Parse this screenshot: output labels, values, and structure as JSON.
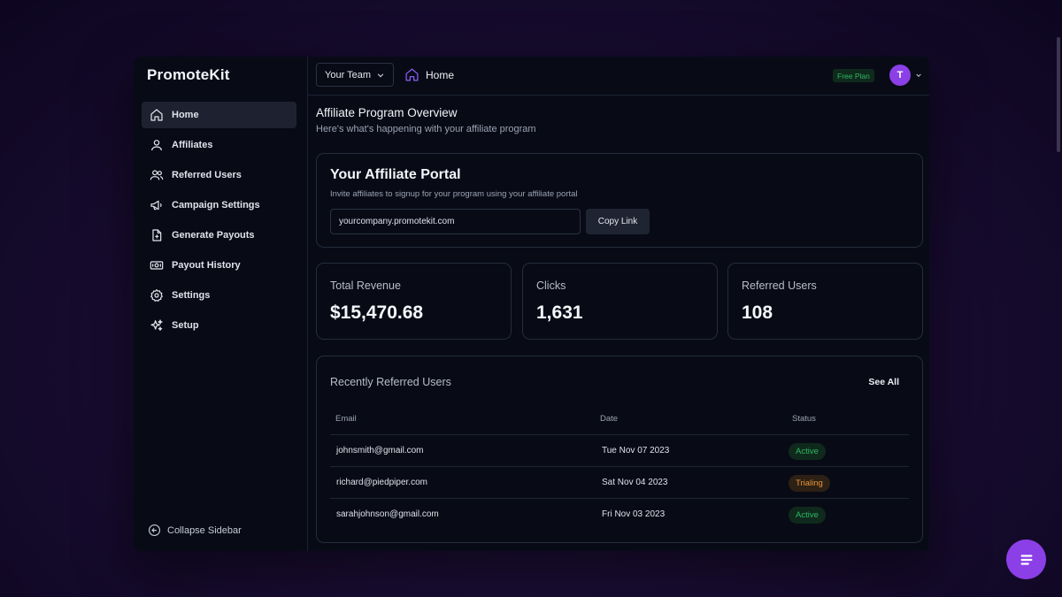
{
  "app": {
    "name": "PromoteKit"
  },
  "sidebar": {
    "items": [
      {
        "label": "Home",
        "icon": "home-icon"
      },
      {
        "label": "Affiliates",
        "icon": "user-icon"
      },
      {
        "label": "Referred Users",
        "icon": "users-icon"
      },
      {
        "label": "Campaign Settings",
        "icon": "megaphone-icon"
      },
      {
        "label": "Generate Payouts",
        "icon": "file-plus-icon"
      },
      {
        "label": "Payout History",
        "icon": "banknote-icon"
      },
      {
        "label": "Settings",
        "icon": "gear-icon"
      },
      {
        "label": "Setup",
        "icon": "sparkles-icon"
      }
    ],
    "collapse_label": "Collapse Sidebar"
  },
  "topbar": {
    "team_select": "Your Team",
    "breadcrumb": "Home",
    "plan": "Free Plan",
    "avatar_initial": "T"
  },
  "overview": {
    "title": "Affiliate Program Overview",
    "subtitle": "Here's what's happening with your affiliate program"
  },
  "portal": {
    "title": "Your Affiliate Portal",
    "subtitle": "Invite affiliates to signup for your program using your affiliate portal",
    "url": "yourcompany.promotekit.com",
    "copy_label": "Copy Link"
  },
  "stats": [
    {
      "label": "Total Revenue",
      "value": "$15,470.68"
    },
    {
      "label": "Clicks",
      "value": "1,631"
    },
    {
      "label": "Referred Users",
      "value": "108"
    }
  ],
  "recent": {
    "title": "Recently Referred Users",
    "see_all": "See All",
    "columns": [
      "Email",
      "Date",
      "Status"
    ],
    "rows": [
      {
        "email": "johnsmith@gmail.com",
        "date": "Tue Nov 07 2023",
        "status": "Active"
      },
      {
        "email": "richard@piedpiper.com",
        "date": "Sat Nov 04 2023",
        "status": "Trialing"
      },
      {
        "email": "sarahjohnson@gmail.com",
        "date": "Fri Nov 03 2023",
        "status": "Active"
      }
    ]
  },
  "colors": {
    "accent": "#8b3fe6",
    "active_status": "#2fb564",
    "trialing_status": "#e8953a"
  }
}
